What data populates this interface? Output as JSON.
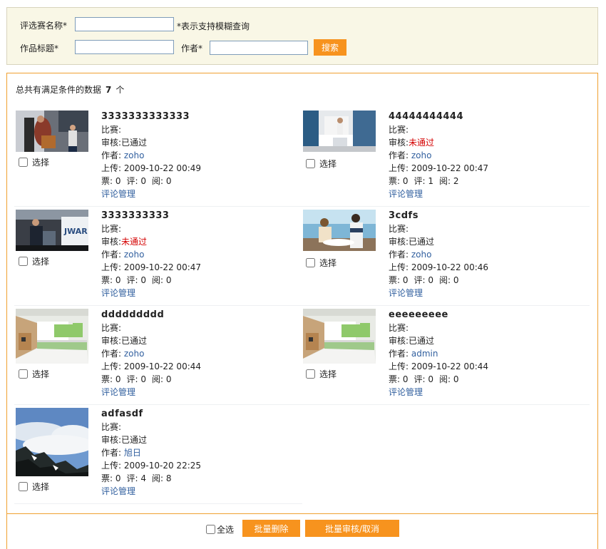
{
  "search": {
    "competition_label": "评选赛名称*",
    "competition_value": "",
    "fuzzy_hint": "*表示支持模糊查询",
    "title_label": "作品标题*",
    "title_value": "",
    "author_label": "作者*",
    "author_value": "",
    "search_button": "搜索"
  },
  "summary": {
    "prefix": "总共有满足条件的数据",
    "count": "7",
    "suffix": "个"
  },
  "labels": {
    "select": "选择",
    "contest": "比赛:",
    "review": "审核:",
    "author": "作者:",
    "upload": "上传:",
    "votes": "票:",
    "comments": "评:",
    "views": "阅:",
    "comment_manage": "评论管理"
  },
  "items": [
    {
      "title": "3333333333333",
      "contest": "",
      "status": "已通过",
      "author": "zoho",
      "uploaded": "2009-10-22 00:49",
      "votes": "0",
      "comments": "0",
      "views": "0",
      "thumb": "people-cloth"
    },
    {
      "title": "44444444444",
      "contest": "",
      "status": "未通过",
      "author": "zoho",
      "uploaded": "2009-10-22 00:47",
      "votes": "0",
      "comments": "1",
      "views": "2",
      "thumb": "kitchen-room"
    },
    {
      "title": "3333333333",
      "contest": "",
      "status": "未通过",
      "author": "zoho",
      "uploaded": "2009-10-22 00:47",
      "votes": "0",
      "comments": "0",
      "views": "0",
      "thumb": "woman-store"
    },
    {
      "title": "3cdfs",
      "contest": "",
      "status": "已通过",
      "author": "zoho",
      "uploaded": "2009-10-22 00:46",
      "votes": "0",
      "comments": "0",
      "views": "0",
      "thumb": "women-cafe"
    },
    {
      "title": "ddddddddd",
      "contest": "",
      "status": "已通过",
      "author": "zoho",
      "uploaded": "2009-10-22 00:44",
      "votes": "0",
      "comments": "0",
      "views": "0",
      "thumb": "green-kitchen"
    },
    {
      "title": "eeeeeeeee",
      "contest": "",
      "status": "已通过",
      "author": "admin",
      "uploaded": "2009-10-22 00:44",
      "votes": "0",
      "comments": "0",
      "views": "0",
      "thumb": "green-kitchen"
    },
    {
      "title": "adfasdf",
      "contest": "",
      "status": "已通过",
      "author": "旭日",
      "uploaded": "2009-10-20 22:25",
      "votes": "0",
      "comments": "4",
      "views": "8",
      "thumb": "mountain-clouds"
    }
  ],
  "footer": {
    "select_all": "全选",
    "batch_delete": "批量删除",
    "batch_review": "批量审核/取消"
  },
  "colors": {
    "accent": "#f7931e",
    "rejected": "#d40000",
    "link": "#32609f",
    "panel_bg": "#f9f7e6"
  }
}
